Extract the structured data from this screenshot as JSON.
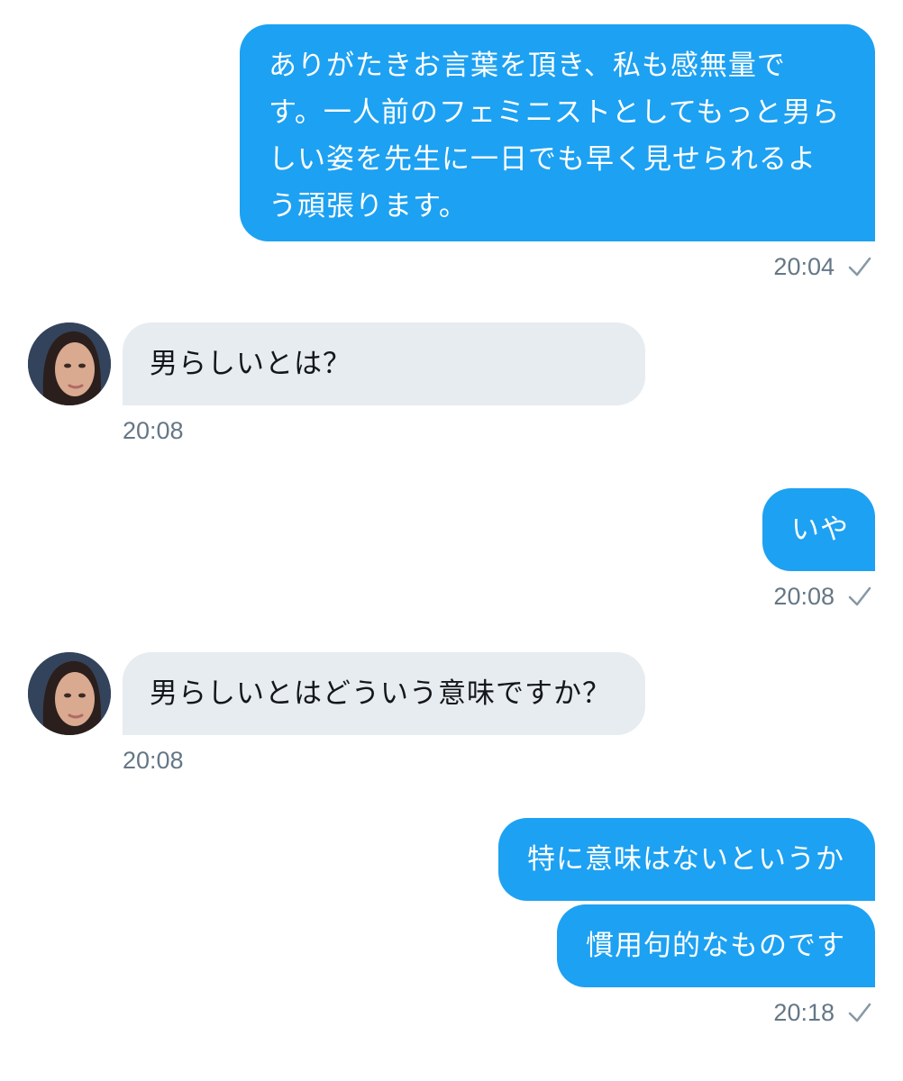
{
  "conversation": {
    "messages": [
      {
        "direction": "outgoing",
        "lines": [
          "ありがたきお言葉を頂き、私も感無量で",
          "す。一人前のフェミニストとしてもっと男ら",
          "しい姿を先生に一日でも早く見せられるよ",
          "う頑張ります。"
        ],
        "time": "20:04",
        "status_icon": "check-icon"
      },
      {
        "direction": "incoming",
        "text": "男らしいとは？",
        "time": "20:08",
        "avatar_icon": "avatar"
      },
      {
        "direction": "outgoing",
        "text": "いや",
        "time": "20:08",
        "status_icon": "check-icon"
      },
      {
        "direction": "incoming",
        "text": "男らしいとはどういう意味ですか？",
        "time": "20:08",
        "avatar_icon": "avatar"
      },
      {
        "direction": "outgoing",
        "text": "特に意味はないというか"
      },
      {
        "direction": "outgoing",
        "text": "慣用句的なものです",
        "time": "20:18",
        "status_icon": "check-icon"
      }
    ]
  },
  "colors": {
    "outgoing_bubble": "#1da1f2",
    "incoming_bubble": "#e6ecf0",
    "timestamp": "#657786",
    "check": "#8899a6"
  }
}
